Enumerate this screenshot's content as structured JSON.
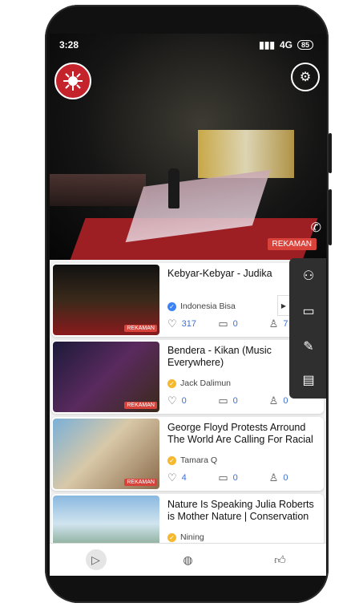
{
  "status_bar": {
    "time": "3:28",
    "network": "4G",
    "battery": "85"
  },
  "player": {
    "badge": "REKAMAN"
  },
  "videos": [
    {
      "title": "Kebyar-Kebyar - Judika",
      "channel": "Indonesia Bisa",
      "verified_color": "#3b82f6",
      "likes": "317",
      "comments": "0",
      "viewers": "7",
      "badge": "REKAMAN"
    },
    {
      "title": "Bendera - Kikan (Music Everywhere)",
      "channel": "Jack Dalimun",
      "verified_color": "#f5b82e",
      "likes": "0",
      "comments": "0",
      "viewers": "0",
      "badge": "REKAMAN"
    },
    {
      "title": "George Floyd Protests Arround The World Are Calling For Racial Justic...",
      "channel": "Tamara Q",
      "verified_color": "#f5b82e",
      "likes": "4",
      "comments": "0",
      "viewers": "0",
      "badge": "REKAMAN"
    },
    {
      "title": "Nature Is Speaking Julia Roberts is Mother Nature | Conservation Int...",
      "channel": "Nining",
      "verified_color": "#f5b82e",
      "likes": "",
      "comments": "",
      "viewers": "",
      "badge": ""
    }
  ],
  "side_panel": {
    "icons": [
      "group-icon",
      "video-camera-icon",
      "pencil-icon",
      "chat-icon"
    ]
  },
  "bottom_nav": {
    "items": [
      "play-icon",
      "globe-icon",
      "thumbs-up-icon"
    ]
  },
  "colors": {
    "accent_red": "#d9423a",
    "link_blue": "#3a6fd8"
  }
}
